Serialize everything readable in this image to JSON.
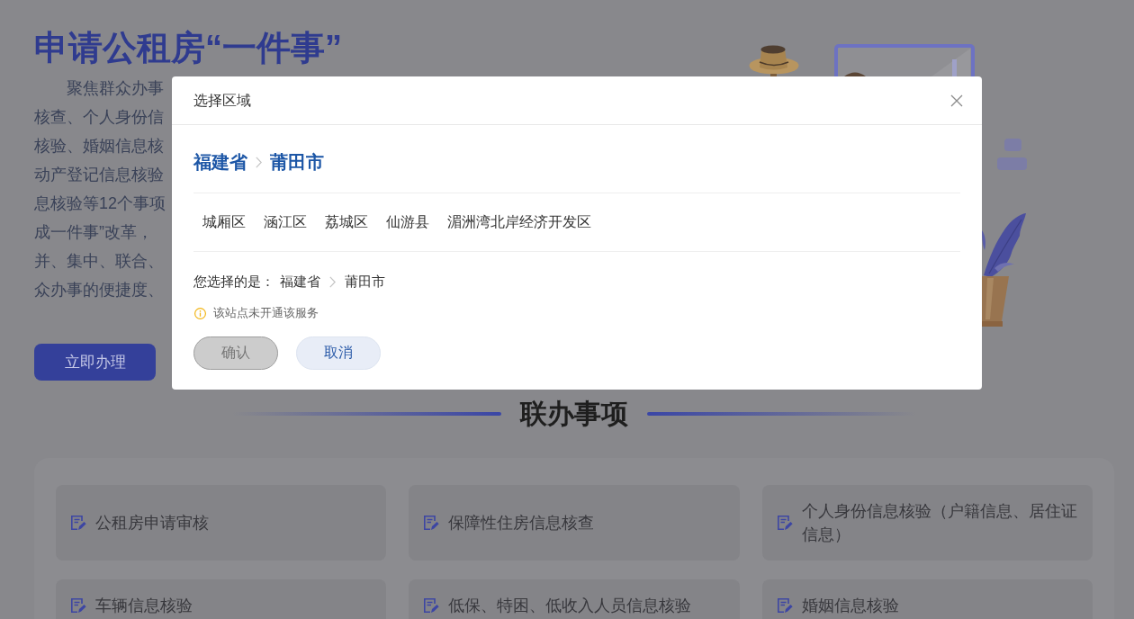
{
  "hero": {
    "title": "申请公租房“一件事”",
    "intro_lines": [
      "聚焦群众办事",
      "核查、个人身份信",
      "核验、婚姻信息核",
      "动产登记信息核验",
      "息核验等12个事项",
      "成一件事”改革，",
      "并、集中、联合、",
      "众办事的便捷度、"
    ],
    "button": "立即办理"
  },
  "section": {
    "title": "联办事项",
    "items": [
      "公租房申请审核",
      "保障性住房信息核查",
      "个人身份信息核验（户籍信息、居住证信息）",
      "车辆信息核验",
      "低保、特困、低收入人员信息核验",
      "婚姻信息核验"
    ]
  },
  "dialog": {
    "title": "选择区域",
    "path": [
      "福建省",
      "莆田市"
    ],
    "options": [
      {
        "label": "城厢区",
        "selected": false
      },
      {
        "label": "涵江区",
        "selected": false
      },
      {
        "label": "荔城区",
        "selected": false
      },
      {
        "label": "仙游县",
        "selected": false
      },
      {
        "label": "湄洲湾北岸经济开发区",
        "selected": false
      }
    ],
    "selection_label": "您选择的是：",
    "selection_path": [
      "福建省",
      "莆田市"
    ],
    "notice": "该站点未开通该服务",
    "buttons": [
      {
        "label": "确认",
        "kind": "primary",
        "disabled": true
      },
      {
        "label": "取消",
        "kind": "secondary",
        "disabled": false
      }
    ]
  }
}
